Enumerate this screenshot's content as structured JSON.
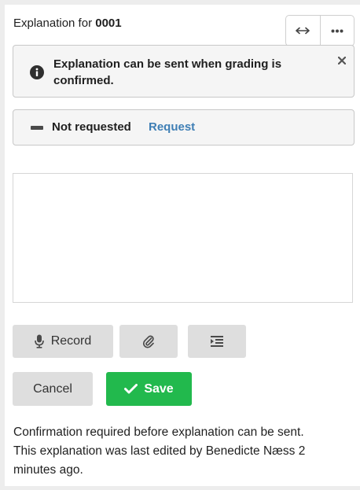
{
  "header": {
    "title_prefix": "Explanation for",
    "title_id": "0001",
    "expand_icon": "horizontal-arrows-icon",
    "more_icon": "ellipsis-icon"
  },
  "notice": {
    "icon": "info-circle-icon",
    "text": "Explanation can be sent when grading is confirmed.",
    "close_icon": "close-icon"
  },
  "request": {
    "icon": "dash-icon",
    "status": "Not requested",
    "link_label": "Request"
  },
  "editor": {
    "value": "",
    "placeholder": ""
  },
  "tools": {
    "record_label": "Record",
    "record_icon": "microphone-icon",
    "attach_icon": "paperclip-icon",
    "indent_icon": "indent-icon"
  },
  "actions": {
    "cancel_label": "Cancel",
    "save_label": "Save",
    "save_icon": "checkmark-icon"
  },
  "footer": {
    "line1": "Confirmation required before explanation can be sent.",
    "line2": "This explanation was last edited by Benedicte Næss 2 minutes ago."
  },
  "colors": {
    "save_green": "#22b94d",
    "link_blue": "#3f7fb5",
    "button_grey": "#dedede"
  }
}
